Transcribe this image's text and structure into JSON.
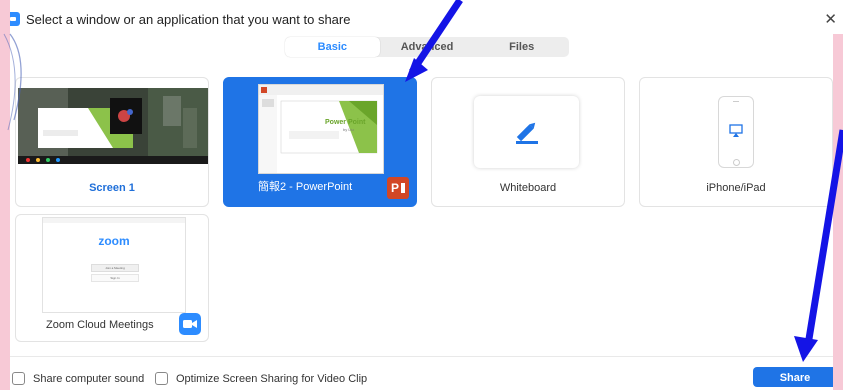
{
  "window": {
    "title": "Select a window or an application that you want to share"
  },
  "tabs": [
    {
      "label": "Basic"
    },
    {
      "label": "Advanced"
    },
    {
      "label": "Files"
    }
  ],
  "cards": {
    "screen1": {
      "label": "Screen 1"
    },
    "powerpoint": {
      "label": "簡報2 - PowerPoint",
      "thumb_title": "Power Point",
      "thumb_subtitle": "by Liu"
    },
    "whiteboard": {
      "label": "Whiteboard"
    },
    "iphone": {
      "label": "iPhone/iPad"
    },
    "zoom": {
      "label": "Zoom Cloud Meetings",
      "thumb_logo": "zoom",
      "thumb_join": "Join a Meeting",
      "thumb_signin": "Sign In"
    }
  },
  "footer": {
    "share_sound_label": "Share computer sound",
    "optimize_label": "Optimize Screen Sharing for Video Clip",
    "share_button_label": "Share"
  },
  "colors": {
    "accent": "#1f74e6",
    "annotation": "#1414e6",
    "background": "#f7c9d6"
  }
}
